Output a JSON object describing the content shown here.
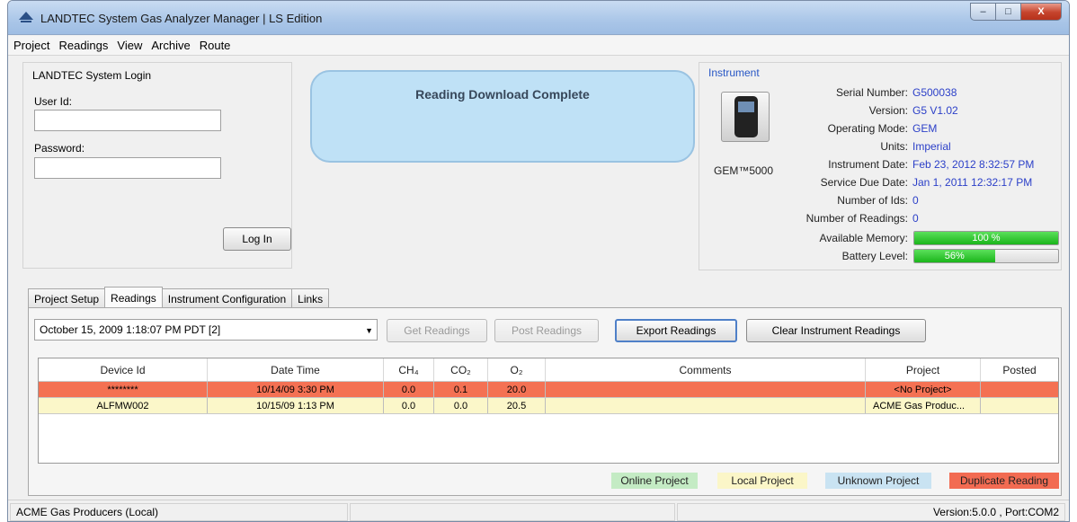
{
  "window": {
    "title": "LANDTEC System Gas Analyzer Manager | LS Edition",
    "minimize_glyph": "–",
    "maximize_glyph": "□",
    "close_glyph": "X"
  },
  "menu": [
    "Project",
    "Readings",
    "View",
    "Archive",
    "Route"
  ],
  "login": {
    "title": "LANDTEC System Login",
    "user_label": "User Id:",
    "password_label": "Password:",
    "login_button": "Log In"
  },
  "status_message": "Reading Download Complete",
  "instrument": {
    "title": "Instrument",
    "model": "GEM™5000",
    "fields": [
      {
        "label": "Serial Number:",
        "value": "G500038"
      },
      {
        "label": "Version:",
        "value": "G5 V1.02"
      },
      {
        "label": "Operating Mode:",
        "value": "GEM"
      },
      {
        "label": "Units:",
        "value": "Imperial"
      },
      {
        "label": "Instrument Date:",
        "value": "Feb 23, 2012 8:32:57 PM"
      },
      {
        "label": "Service Due Date:",
        "value": "Jan 1, 2011 12:32:17 PM"
      },
      {
        "label": "Number of Ids:",
        "value": "0"
      },
      {
        "label": "Number of Readings:",
        "value": "0"
      }
    ],
    "memory": {
      "label": "Available Memory:",
      "text": "100 %",
      "level": 1.0
    },
    "battery": {
      "label": "Battery Level:",
      "text": "56%",
      "level": 0.56
    }
  },
  "tabs": [
    "Project Setup",
    "Readings",
    "Instrument Configuration",
    "Links"
  ],
  "active_tab": "Readings",
  "readings": {
    "selected_session": "October 15, 2009 1:18:07 PM PDT [2]",
    "buttons": {
      "get": "Get Readings",
      "post": "Post Readings",
      "export": "Export Readings",
      "clear": "Clear Instrument Readings"
    },
    "columns": [
      "Device Id",
      "Date Time",
      "CH₄",
      "CO₂",
      "O₂",
      "Comments",
      "Project",
      "Posted"
    ],
    "rows": [
      {
        "device": "********",
        "datetime": "10/14/09 3:30 PM",
        "ch4": "0.0",
        "co2": "0.1",
        "o2": "20.0",
        "comments": "",
        "project": "<No Project>",
        "posted": "",
        "status": "duplicate"
      },
      {
        "device": "ALFMW002",
        "datetime": "10/15/09 1:13 PM",
        "ch4": "0.0",
        "co2": "0.0",
        "o2": "20.5",
        "comments": "",
        "project": "ACME Gas Produc...",
        "posted": "",
        "status": "local"
      }
    ],
    "legend": [
      {
        "label": "Online Project",
        "color": "#c4ebc4"
      },
      {
        "label": "Local Project",
        "color": "#fbf6c8"
      },
      {
        "label": "Unknown Project",
        "color": "#c9e3f2"
      },
      {
        "label": "Duplicate Reading",
        "color": "#f26b52"
      }
    ]
  },
  "colors": {
    "duplicate_row": "#f47153",
    "local_row": "#fbf7c9",
    "link_value": "#2b3fc8"
  },
  "statusbar": {
    "project": "ACME Gas Producers (Local)",
    "version": "Version:5.0.0 , Port:COM2"
  }
}
